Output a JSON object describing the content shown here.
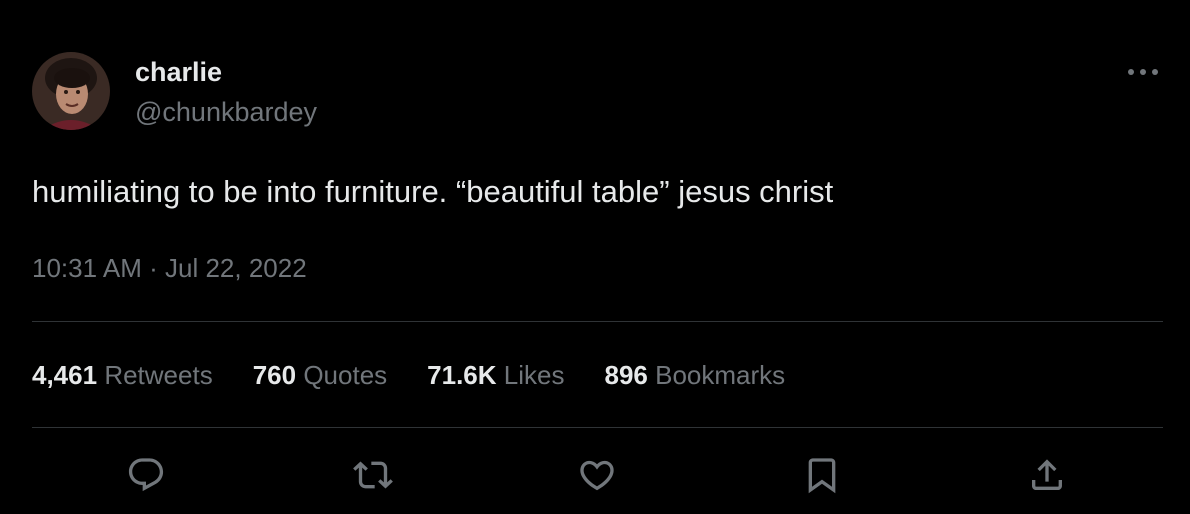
{
  "author": {
    "display_name": "charlie",
    "handle": "@chunkbardey",
    "avatar": "profile-photo"
  },
  "tweet": {
    "text": "humiliating to be into furniture. “beautiful table” jesus christ",
    "time": "10:31 AM",
    "separator": "·",
    "date": "Jul 22, 2022"
  },
  "stats": {
    "retweets": {
      "count": "4,461",
      "label": "Retweets"
    },
    "quotes": {
      "count": "760",
      "label": "Quotes"
    },
    "likes": {
      "count": "71.6K",
      "label": "Likes"
    },
    "bookmarks": {
      "count": "896",
      "label": "Bookmarks"
    }
  },
  "actions": {
    "reply": "reply-icon",
    "retweet": "retweet-icon",
    "like": "heart-icon",
    "bookmark": "bookmark-icon",
    "share": "share-icon"
  },
  "colors": {
    "background": "#000000",
    "primary_text": "#e7e9ea",
    "secondary_text": "#71767b",
    "divider": "#2f3336"
  }
}
